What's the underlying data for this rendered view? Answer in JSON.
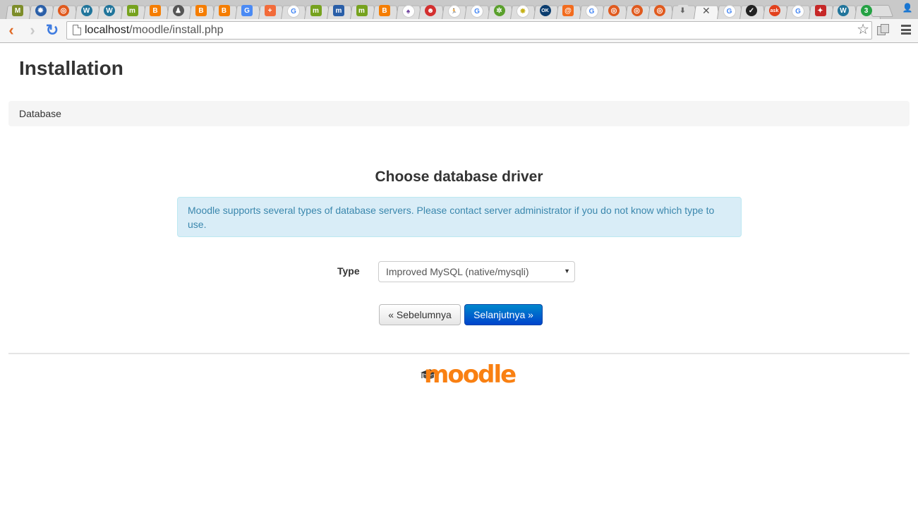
{
  "browser": {
    "tabs": [
      {
        "icon": "moodle-doc-icon",
        "color": "#7d8d2a",
        "glyph": "M",
        "shape": "sq"
      },
      {
        "icon": "gear-badge-icon",
        "color": "#2a5fa8",
        "glyph": "✹"
      },
      {
        "icon": "ubuntu-icon",
        "color": "#e05a1e",
        "glyph": "◎"
      },
      {
        "icon": "wordpress-icon",
        "color": "#21759b",
        "glyph": "W"
      },
      {
        "icon": "wordpress-icon",
        "color": "#21759b",
        "glyph": "W"
      },
      {
        "icon": "moodle-n-icon",
        "color": "#76a21e",
        "glyph": "m",
        "shape": "sq"
      },
      {
        "icon": "blogger-icon",
        "color": "#f57d00",
        "glyph": "B",
        "shape": "sq"
      },
      {
        "icon": "person-icon",
        "color": "#555555",
        "glyph": "♟"
      },
      {
        "icon": "blogger-icon",
        "color": "#f57d00",
        "glyph": "B",
        "shape": "sq"
      },
      {
        "icon": "blogger-icon",
        "color": "#f57d00",
        "glyph": "B",
        "shape": "sq"
      },
      {
        "icon": "google-translate-icon",
        "color": "#4a8af4",
        "glyph": "G",
        "shape": "sq"
      },
      {
        "icon": "plus-icon",
        "color": "#f26b3a",
        "glyph": "+",
        "shape": "sq"
      },
      {
        "icon": "google-icon",
        "color": "#ffffff",
        "glyph": "G",
        "text": "#4285f4"
      },
      {
        "icon": "moodle-n-icon",
        "color": "#76a21e",
        "glyph": "m",
        "shape": "sq"
      },
      {
        "icon": "moodle-n-icon",
        "color": "#2a5fa8",
        "glyph": "m",
        "shape": "sq"
      },
      {
        "icon": "moodle-n-icon",
        "color": "#76a21e",
        "glyph": "m",
        "shape": "sq"
      },
      {
        "icon": "blogger-icon",
        "color": "#f57d00",
        "glyph": "B",
        "shape": "sq"
      },
      {
        "icon": "spade-icon",
        "color": "#ffffff",
        "glyph": "♠",
        "text": "#6b3e9c"
      },
      {
        "icon": "mascot-icon",
        "color": "#d32f2f",
        "glyph": "☻"
      },
      {
        "icon": "runner-icon",
        "color": "#ffffff",
        "glyph": "🏃",
        "text": "#2e7d32"
      },
      {
        "icon": "google-icon",
        "color": "#ffffff",
        "glyph": "G",
        "text": "#4285f4"
      },
      {
        "icon": "bug-icon",
        "color": "#5aa02c",
        "glyph": "✲"
      },
      {
        "icon": "sparkle-icon",
        "color": "#ffffff",
        "glyph": "✸",
        "text": "#c6b21a"
      },
      {
        "icon": "ok-icon",
        "color": "#0b3d6f",
        "glyph": "OK"
      },
      {
        "icon": "hitcounter-icon",
        "color": "#f26b1d",
        "glyph": "@",
        "shape": "sq"
      },
      {
        "icon": "google-icon",
        "color": "#ffffff",
        "glyph": "G",
        "text": "#4285f4"
      },
      {
        "icon": "ubuntu-icon",
        "color": "#e05a1e",
        "glyph": "◎"
      },
      {
        "icon": "ubuntu-icon",
        "color": "#e05a1e",
        "glyph": "◎"
      },
      {
        "icon": "ubuntu-icon",
        "color": "#e05a1e",
        "glyph": "◎"
      },
      {
        "icon": "download-icon",
        "color": "#dedede",
        "glyph": "⬇",
        "text": "#666666",
        "shape": "sq"
      },
      {
        "icon": "close-icon",
        "active": true
      },
      {
        "icon": "google-icon",
        "color": "#ffffff",
        "glyph": "G",
        "text": "#4285f4"
      },
      {
        "icon": "check-circle-icon",
        "color": "#222222",
        "glyph": "✓"
      },
      {
        "icon": "ask-icon",
        "color": "#e2411c",
        "glyph": "ask"
      },
      {
        "icon": "google-icon",
        "color": "#ffffff",
        "glyph": "G",
        "text": "#4285f4"
      },
      {
        "icon": "shield-fox-icon",
        "color": "#c62828",
        "glyph": "✦",
        "shape": "sq"
      },
      {
        "icon": "wordpress-icon",
        "color": "#21759b",
        "glyph": "W"
      },
      {
        "icon": "whatsapp-icon",
        "color": "#25a244",
        "glyph": "3"
      }
    ],
    "close_tab_glyph": "✕",
    "url_host": "localhost",
    "url_path": "/moodle/install.php"
  },
  "page": {
    "title": "Installation",
    "breadcrumb": "Database",
    "heading": "Choose database driver",
    "info": "Moodle supports several types of database servers. Please contact server administrator if you do not know which type to use.",
    "type_label": "Type",
    "type_value": "Improved MySQL (native/mysqli)",
    "prev_button": "« Sebelumnya",
    "next_button": "Selanjutnya »",
    "logo_text": "moodle",
    "colors": {
      "accent": "#f98012",
      "primary_button": "#0055cc",
      "info_bg": "#d9edf7",
      "info_text": "#3a87ad"
    }
  }
}
